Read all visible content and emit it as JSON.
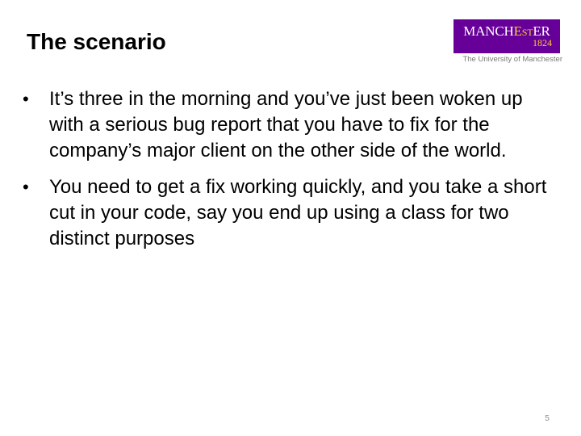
{
  "slide": {
    "title": "The scenario",
    "bullets": [
      "It’s three in the morning and you’ve just been woken up with a serious bug report that you have to fix for the company’s major client on the other side of the world.",
      "You need to get a fix working quickly, and you take a short cut in your code, say you end up using a class for two distinct purposes"
    ],
    "bullet_marker": "•",
    "page_number": "5"
  },
  "logo": {
    "word_part1": "MANCH",
    "word_part2": "E",
    "word_part3": "ST",
    "word_part4": "ER",
    "year": "1824",
    "subtitle": "The University of Manchester",
    "colors": {
      "purple": "#660099",
      "gold": "#ffcc33",
      "white": "#ffffff"
    }
  }
}
